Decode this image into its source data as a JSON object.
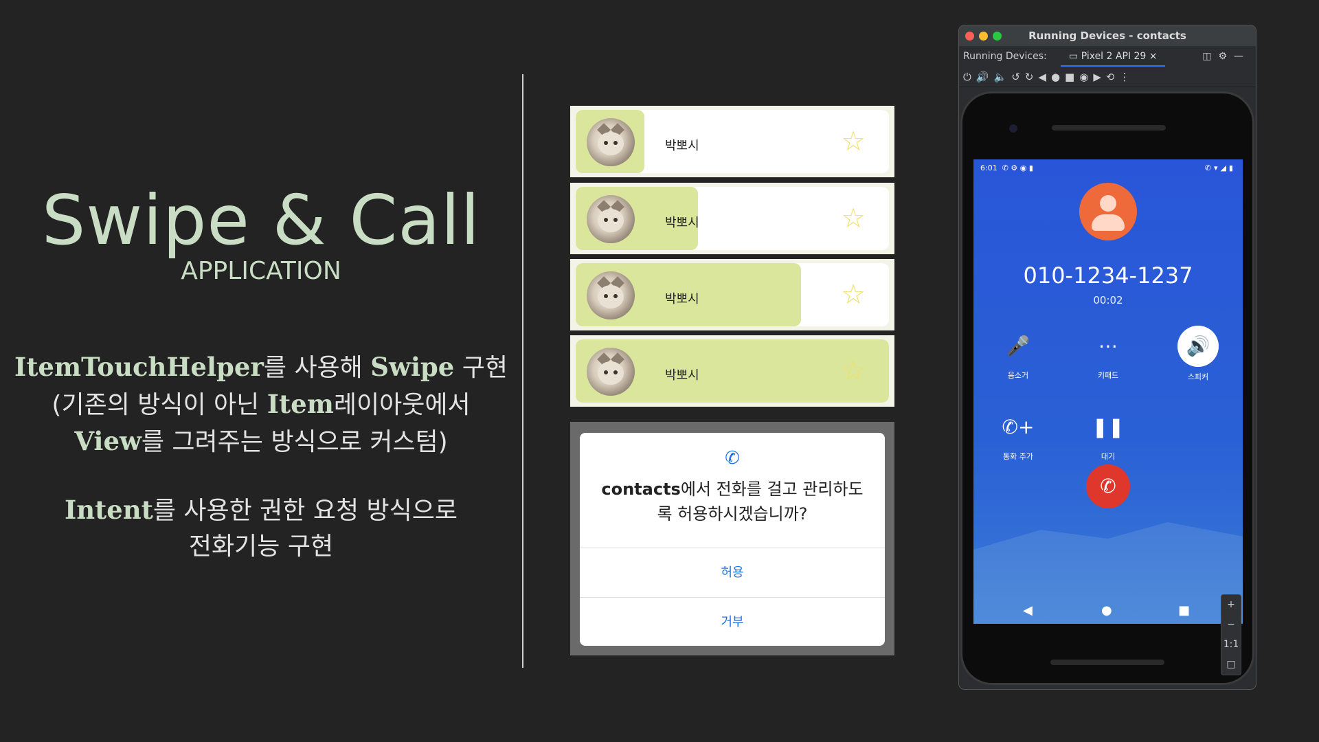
{
  "slide": {
    "title": "Swipe & Call",
    "subtitle": "APPLICATION",
    "desc1": {
      "b1": "ItemTouchHelper",
      "t1": "를 사용해 ",
      "b2": "Swipe",
      "t2": " 구현",
      "t3": "(기존의 방식이 아닌 ",
      "b3": "Item",
      "t4": "레이아웃에서",
      "b4": "View",
      "t5": "를 그려주는 방식으로 커스텀)"
    },
    "desc2": {
      "b1": "Intent",
      "t1": "를 사용한 권한 요청 방식으로",
      "t2": "전화기능 구현"
    }
  },
  "list": {
    "items": [
      {
        "name": "박뽀시",
        "swipe_fraction": 0.22
      },
      {
        "name": "박뽀시",
        "swipe_fraction": 0.39
      },
      {
        "name": "박뽀시",
        "swipe_fraction": 0.72
      },
      {
        "name": "박뽀시",
        "swipe_fraction": 1.0
      }
    ],
    "star_icon": "star-outline-icon"
  },
  "dialog": {
    "app": "contacts",
    "message_line1": "에서 전화를 걸고 관리하도",
    "message_line2": "록 허용하시겠습니까?",
    "allow": "허용",
    "deny": "거부"
  },
  "emulator": {
    "window_title": "Running Devices - contacts",
    "running_label": "Running Devices:",
    "device_tab": "Pixel 2 API 29",
    "status_time": "6:01",
    "phone_number": "010-1234-1237",
    "call_timer": "00:02",
    "controls": [
      {
        "label": "음소거",
        "icon": "mic-off-icon"
      },
      {
        "label": "키패드",
        "icon": "dialpad-icon"
      },
      {
        "label": "스피커",
        "icon": "speaker-icon"
      },
      {
        "label": "통화 추가",
        "icon": "add-call-icon"
      },
      {
        "label": "대기",
        "icon": "pause-icon"
      }
    ],
    "zoom": {
      "plus": "+",
      "minus": "−",
      "ratio": "1:1"
    }
  },
  "colors": {
    "accent_green": "#d9e69c",
    "title_green": "#c9dcc4",
    "android_blue": "#2956d8",
    "hangup_red": "#e0372c",
    "caller_orange": "#ef6a3a"
  }
}
